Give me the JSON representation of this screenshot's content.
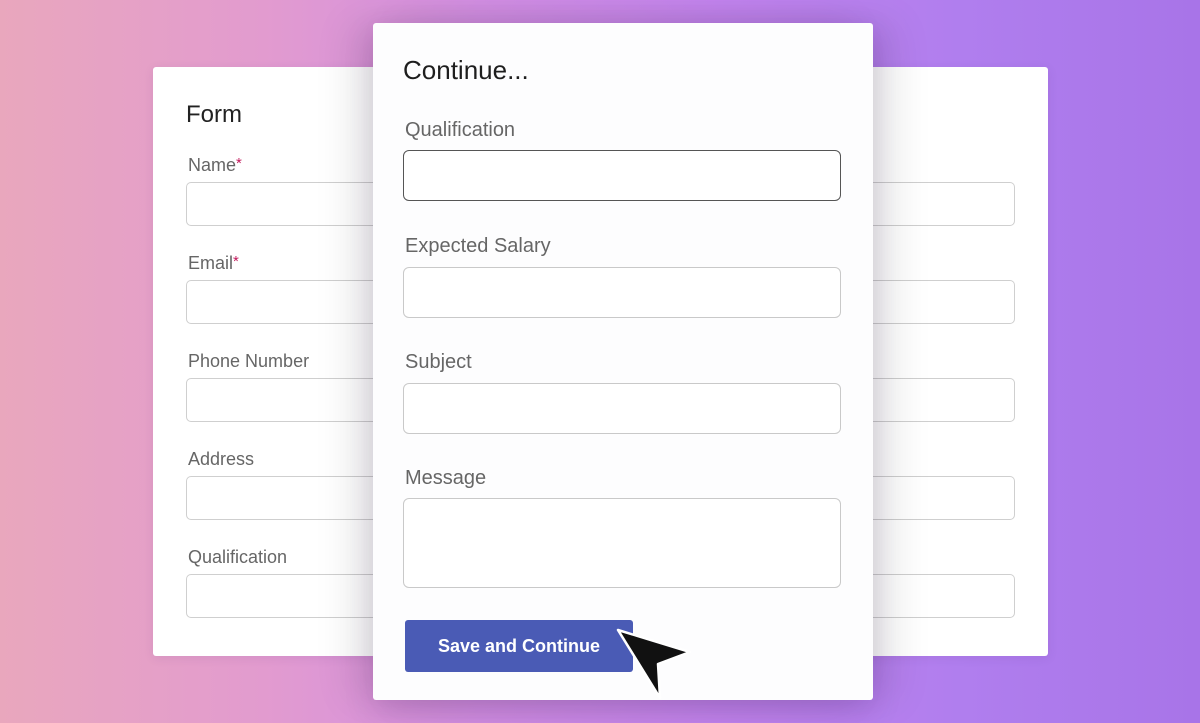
{
  "background_form": {
    "title": "Form",
    "fields": [
      {
        "label": "Name",
        "required": true,
        "required_mark": "*",
        "value": ""
      },
      {
        "label": "Email",
        "required": true,
        "required_mark": "*",
        "value": ""
      },
      {
        "label": "Phone Number",
        "required": false,
        "value": ""
      },
      {
        "label": "Address",
        "required": false,
        "value": ""
      },
      {
        "label": "Qualification",
        "required": false,
        "value": ""
      }
    ]
  },
  "continue_form": {
    "title": "Continue...",
    "fields": [
      {
        "label": "Qualification",
        "value": "",
        "focused": true
      },
      {
        "label": "Expected Salary",
        "value": ""
      },
      {
        "label": "Subject",
        "value": ""
      },
      {
        "label": "Message",
        "value": "",
        "multiline": true
      }
    ],
    "submit_label": "Save and Continue"
  },
  "colors": {
    "button": "#4a5bb5",
    "required_mark": "#c2185b",
    "gradient_start": "#e9a7bd",
    "gradient_end": "#a874e8"
  },
  "cursor": {
    "icon": "mouse-pointer-icon"
  }
}
